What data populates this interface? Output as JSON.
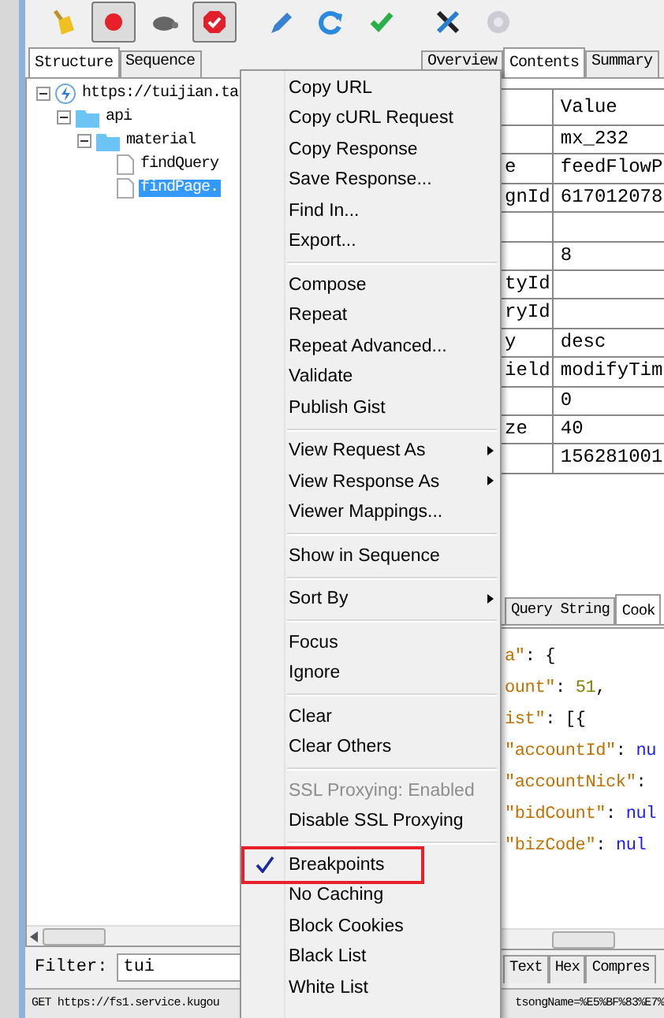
{
  "toolbar": {
    "buttons": [
      {
        "kind": "broom",
        "pressed": false,
        "disabled": false
      },
      {
        "kind": "record",
        "pressed": true,
        "disabled": false
      },
      {
        "kind": "turtle",
        "pressed": false,
        "disabled": false
      },
      {
        "kind": "breakpoint",
        "pressed": true,
        "disabled": false
      },
      {
        "kind": "pen",
        "pressed": false,
        "disabled": false
      },
      {
        "kind": "refresh",
        "pressed": false,
        "disabled": false
      },
      {
        "kind": "check",
        "pressed": false,
        "disabled": false
      },
      {
        "kind": "tools",
        "pressed": false,
        "disabled": false
      },
      {
        "kind": "gear",
        "pressed": false,
        "disabled": true
      }
    ]
  },
  "left_panel": {
    "tabs": [
      {
        "label": "Structure",
        "selected": true
      },
      {
        "label": "Sequence",
        "selected": false
      }
    ],
    "tree": [
      {
        "label": "https://tuijian.ta",
        "kind": "host",
        "expanded": true,
        "selected": false,
        "children": [
          {
            "label": "api",
            "kind": "folder",
            "expanded": true,
            "selected": false,
            "children": [
              {
                "label": "material",
                "kind": "folder",
                "expanded": true,
                "selected": false,
                "children": [
                  {
                    "label": "findQuery",
                    "kind": "file",
                    "selected": false
                  },
                  {
                    "label": "findPage.",
                    "kind": "file",
                    "selected": true
                  }
                ]
              }
            ]
          }
        ]
      }
    ],
    "filter": {
      "label": "Filter:",
      "value": "tui"
    }
  },
  "right_panel": {
    "tabs": [
      {
        "label": "Overview",
        "selected": false
      },
      {
        "label": "Contents",
        "selected": true
      },
      {
        "label": "Summary",
        "selected": false
      }
    ],
    "table": {
      "header": "Value",
      "rows": [
        {
          "value": "mx_232"
        },
        {
          "name": "e",
          "value": "feedFlowP"
        },
        {
          "name": "gnId",
          "value": "617012078"
        },
        {},
        {
          "value": "8"
        },
        {
          "name": "tyId"
        },
        {
          "name": "ryId"
        },
        {
          "name": "y",
          "value": "desc"
        },
        {
          "name": "ield",
          "value": "modifyTim"
        },
        {
          "value": "0"
        },
        {
          "name": "ze",
          "value": "40"
        },
        {
          "value": "156281001"
        }
      ]
    },
    "lower_tabs": [
      {
        "label": "Query String",
        "selected": false
      },
      {
        "label": "Cook",
        "selected": true
      }
    ],
    "body_lines": [
      [
        {
          "kind": "key",
          "text": "a\""
        },
        {
          "kind": "punct",
          "text": ": {"
        }
      ],
      [
        {
          "kind": "key",
          "text": "ount\""
        },
        {
          "kind": "punct",
          "text": ": "
        },
        {
          "kind": "number",
          "text": "51"
        },
        {
          "kind": "punct",
          "text": ","
        }
      ],
      [
        {
          "kind": "key",
          "text": "ist\""
        },
        {
          "kind": "punct",
          "text": ": [{"
        }
      ],
      [
        {
          "kind": "key",
          "text": "\"accountId\""
        },
        {
          "kind": "punct",
          "text": ": "
        },
        {
          "kind": "null",
          "text": "nu"
        }
      ],
      [
        {
          "kind": "key",
          "text": "\"accountNick\""
        },
        {
          "kind": "punct",
          "text": ":"
        }
      ],
      [
        {
          "kind": "key",
          "text": "\"bidCount\""
        },
        {
          "kind": "punct",
          "text": ": "
        },
        {
          "kind": "null",
          "text": "nul"
        }
      ],
      [
        {
          "kind": "key",
          "text": "\"bizCode\""
        },
        {
          "kind": "punct",
          "text": ": "
        },
        {
          "kind": "null",
          "text": "nul"
        }
      ]
    ],
    "bottom_tabs": [
      "Text",
      "Hex",
      "Compres"
    ]
  },
  "status_bar": {
    "left": "GET https://fs1.service.kugou",
    "right": "tsongName=%E5%BF%83%E7%"
  },
  "context_menu": {
    "groups": [
      [
        {
          "label": "Copy URL",
          "submenu": false,
          "disabled": false,
          "checked": false,
          "outlined": false
        },
        {
          "label": "Copy cURL Request",
          "submenu": false,
          "disabled": false,
          "checked": false,
          "outlined": false
        },
        {
          "label": "Copy Response",
          "submenu": false,
          "disabled": false,
          "checked": false,
          "outlined": false
        },
        {
          "label": "Save Response...",
          "submenu": false,
          "disabled": false,
          "checked": false,
          "outlined": false
        },
        {
          "label": "Find In...",
          "submenu": false,
          "disabled": false,
          "checked": false,
          "outlined": false
        },
        {
          "label": "Export...",
          "submenu": false,
          "disabled": false,
          "checked": false,
          "outlined": false
        }
      ],
      [
        {
          "label": "Compose",
          "submenu": false,
          "disabled": false,
          "checked": false,
          "outlined": false
        },
        {
          "label": "Repeat",
          "submenu": false,
          "disabled": false,
          "checked": false,
          "outlined": false
        },
        {
          "label": "Repeat Advanced...",
          "submenu": false,
          "disabled": false,
          "checked": false,
          "outlined": false
        },
        {
          "label": "Validate",
          "submenu": false,
          "disabled": false,
          "checked": false,
          "outlined": false
        },
        {
          "label": "Publish Gist",
          "submenu": false,
          "disabled": false,
          "checked": false,
          "outlined": false
        }
      ],
      [
        {
          "label": "View Request As",
          "submenu": true,
          "disabled": false,
          "checked": false,
          "outlined": false
        },
        {
          "label": "View Response As",
          "submenu": true,
          "disabled": false,
          "checked": false,
          "outlined": false
        },
        {
          "label": "Viewer Mappings...",
          "submenu": false,
          "disabled": false,
          "checked": false,
          "outlined": false
        }
      ],
      [
        {
          "label": "Show in Sequence",
          "submenu": false,
          "disabled": false,
          "checked": false,
          "outlined": false
        }
      ],
      [
        {
          "label": "Sort By",
          "submenu": true,
          "disabled": false,
          "checked": false,
          "outlined": false
        }
      ],
      [
        {
          "label": "Focus",
          "submenu": false,
          "disabled": false,
          "checked": false,
          "outlined": false
        },
        {
          "label": "Ignore",
          "submenu": false,
          "disabled": false,
          "checked": false,
          "outlined": false
        }
      ],
      [
        {
          "label": "Clear",
          "submenu": false,
          "disabled": false,
          "checked": false,
          "outlined": false
        },
        {
          "label": "Clear Others",
          "submenu": false,
          "disabled": false,
          "checked": false,
          "outlined": false
        }
      ],
      [
        {
          "label": "SSL Proxying: Enabled",
          "submenu": false,
          "disabled": true,
          "checked": false,
          "outlined": false
        },
        {
          "label": "Disable SSL Proxying",
          "submenu": false,
          "disabled": false,
          "checked": false,
          "outlined": false
        }
      ],
      [
        {
          "label": "Breakpoints",
          "submenu": false,
          "disabled": false,
          "checked": true,
          "outlined": true
        },
        {
          "label": "No Caching",
          "submenu": false,
          "disabled": false,
          "checked": false,
          "outlined": false
        },
        {
          "label": "Block Cookies",
          "submenu": false,
          "disabled": false,
          "checked": false,
          "outlined": false
        },
        {
          "label": "Black List",
          "submenu": false,
          "disabled": false,
          "checked": false,
          "outlined": false
        },
        {
          "label": "White List",
          "submenu": false,
          "disabled": false,
          "checked": false,
          "outlined": false
        }
      ]
    ]
  }
}
